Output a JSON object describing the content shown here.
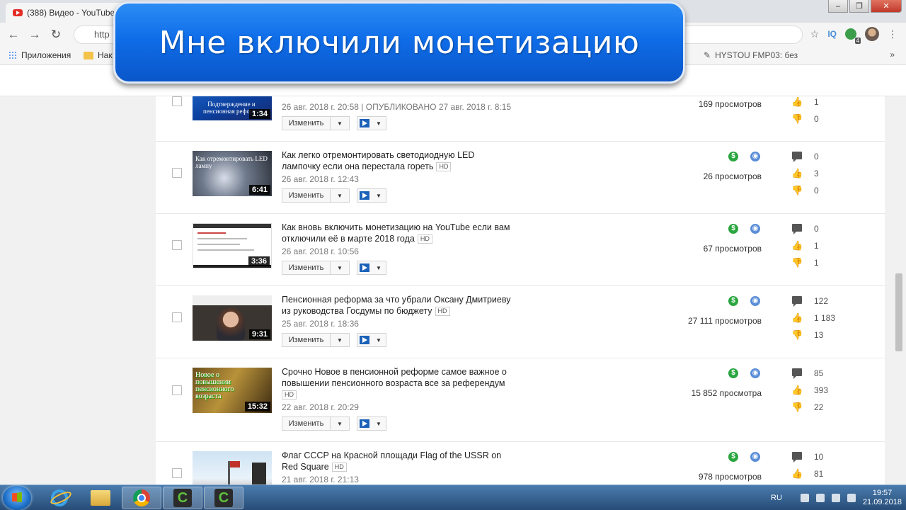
{
  "browser": {
    "tab_title": "(388) Видео - YouTube",
    "url_fragment": "http",
    "bookmarks": [
      "Приложения",
      "Нак",
      "HYSTOU FMP03: без"
    ],
    "ext_badge": "4",
    "ext_iq": "IQ"
  },
  "banner": {
    "text": "Мне включили монетизацию"
  },
  "videos": [
    {
      "title": "",
      "hd": "",
      "date": "26 авг. 2018 г. 20:58 | ОПУБЛИКОВАНО 27 авг. 2018 г. 8:15",
      "duration": "1:34",
      "thumb_caption": "Подтверждение и пенсионная реформа",
      "views": "169 просмотров",
      "comments": "",
      "likes": "1",
      "dislikes": "0",
      "edit_label": "Изменить"
    },
    {
      "title": "Как легко отремонтировать светодиодную LED лампочку если она перестала гореть",
      "hd": "HD",
      "date": "26 авг. 2018 г. 12:43",
      "duration": "6:41",
      "thumb_caption": "Как отремонтировать LED лампу",
      "views": "26 просмотров",
      "comments": "0",
      "likes": "3",
      "dislikes": "0",
      "edit_label": "Изменить"
    },
    {
      "title": "Как вновь включить монетизацию на YouTube если вам отключили её в марте 2018 года",
      "hd": "HD",
      "date": "26 авг. 2018 г. 10:56",
      "duration": "3:36",
      "thumb_caption": "",
      "views": "67 просмотров",
      "comments": "0",
      "likes": "1",
      "dislikes": "1",
      "edit_label": "Изменить"
    },
    {
      "title": "Пенсионная реформа за что убрали Оксану Дмитриеву из руководства Госдумы по бюджету",
      "hd": "HD",
      "date": "25 авг. 2018 г. 18:36",
      "duration": "9:31",
      "thumb_caption": "",
      "views": "27 111 просмотров",
      "comments": "122",
      "likes": "1 183",
      "dislikes": "13",
      "edit_label": "Изменить"
    },
    {
      "title": "Срочно Новое в пенсионной реформе самое важное о повышении пенсионного возраста все за референдум",
      "hd": "HD",
      "date": "22 авг. 2018 г. 20:29",
      "duration": "15:32",
      "thumb_caption": "Новое о повышении пенсионного возраста",
      "views": "15 852 просмотра",
      "comments": "85",
      "likes": "393",
      "dislikes": "22",
      "edit_label": "Изменить"
    },
    {
      "title": "Флаг СССР на Красной площади Flag of the USSR on Red Square",
      "hd": "HD",
      "date": "21 авг. 2018 г. 21:13",
      "duration": "",
      "thumb_caption": "",
      "views": "978 просмотров",
      "comments": "10",
      "likes": "81",
      "dislikes": "",
      "edit_label": "Изменить"
    }
  ],
  "taskbar": {
    "lang": "RU",
    "time": "19:57",
    "date": "21.09.2018"
  },
  "colors": {
    "banner_blue": "#0f6de8",
    "monetization_green": "#2ba640",
    "globe_blue": "#5a8ed8"
  }
}
